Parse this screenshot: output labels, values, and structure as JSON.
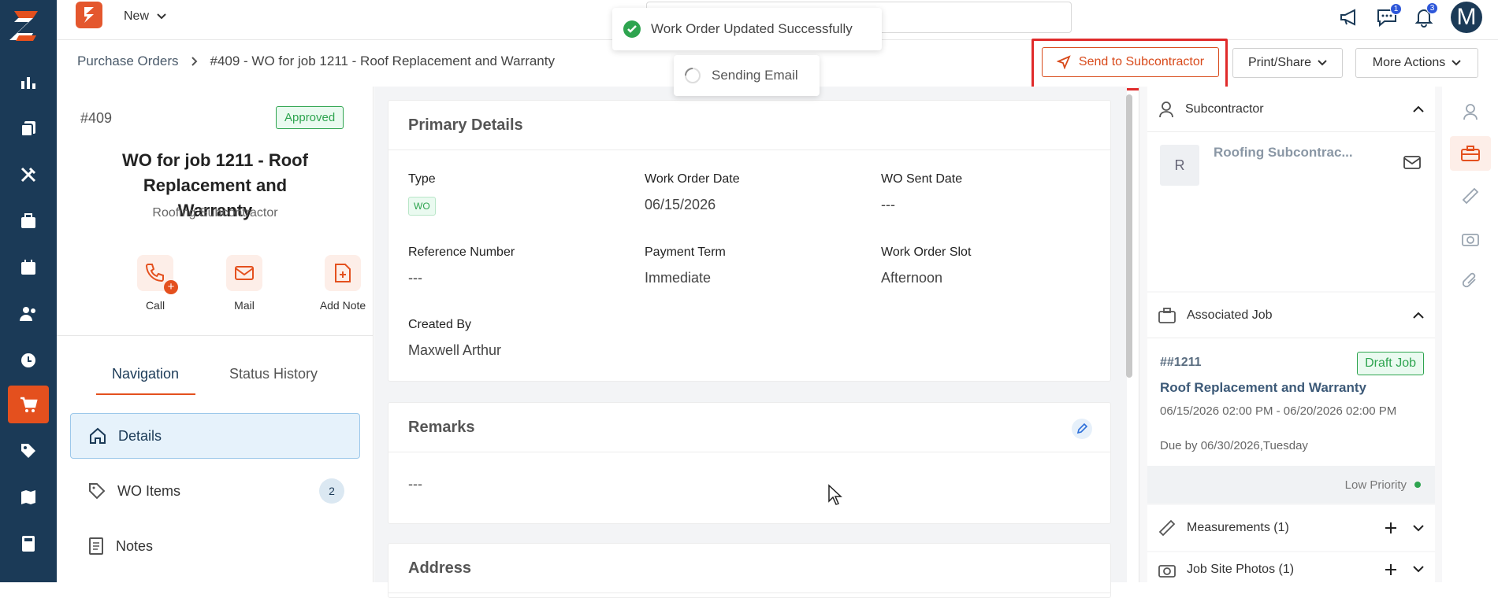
{
  "topbar": {
    "new_label": "New"
  },
  "toasts": {
    "success": "Work Order Updated Successfully",
    "sending": "Sending Email"
  },
  "badges": {
    "chat": "1",
    "notifications": "3"
  },
  "avatar": "M",
  "breadcrumb": {
    "root": "Purchase Orders",
    "current": "#409 - WO for job 1211 - Roof Replacement and Warranty"
  },
  "actions": {
    "send": "Send to Subcontractor",
    "print": "Print/Share",
    "more": "More Actions"
  },
  "wo": {
    "number": "#409",
    "status": "Approved",
    "title": "WO for job 1211 - Roof Replacement and Warranty",
    "subcontractor": "Roofing Subcontractor",
    "quick_actions": {
      "call": "Call",
      "mail": "Mail",
      "add_note": "Add Note"
    }
  },
  "tabs": {
    "navigation": "Navigation",
    "status_history": "Status History"
  },
  "nav": {
    "details": "Details",
    "wo_items": "WO Items",
    "wo_items_count": "2",
    "notes": "Notes"
  },
  "primary": {
    "title": "Primary Details",
    "type_label": "Type",
    "type_value": "WO",
    "wo_date_label": "Work Order Date",
    "wo_date_value": "06/15/2026",
    "sent_label": "WO Sent Date",
    "sent_value": "---",
    "ref_label": "Reference Number",
    "ref_value": "---",
    "payment_label": "Payment Term",
    "payment_value": "Immediate",
    "slot_label": "Work Order Slot",
    "slot_value": "Afternoon",
    "created_label": "Created By",
    "created_value": "Maxwell Arthur"
  },
  "remarks": {
    "title": "Remarks",
    "value": "---"
  },
  "address": {
    "title": "Address"
  },
  "right": {
    "subcontractor_title": "Subcontractor",
    "sub_initial": "R",
    "sub_name": "Roofing Subcontrac...",
    "assoc_title": "Associated Job",
    "job_number": "##1211",
    "job_status": "Draft Job",
    "job_name": "Roof Replacement and Warranty",
    "job_dates": "06/15/2026 02:00 PM - 06/20/2026 02:00 PM",
    "job_due": "Due by 06/30/2026,Tuesday",
    "priority": "Low Priority",
    "measurements": "Measurements (1)",
    "photos": "Job Site Photos (1)"
  }
}
